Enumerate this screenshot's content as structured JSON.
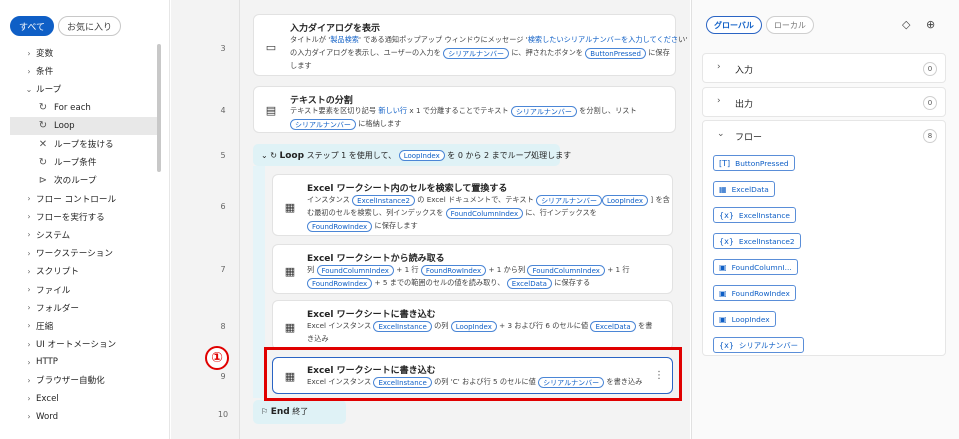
{
  "left_panel": {
    "chips": [
      "すべて",
      "お気に入り"
    ],
    "tree": [
      {
        "label": "変数",
        "type": "group"
      },
      {
        "label": "条件",
        "type": "group"
      },
      {
        "label": "ループ",
        "type": "group-open"
      },
      {
        "label": "For each",
        "type": "child",
        "icon": "loop-icon"
      },
      {
        "label": "Loop",
        "type": "child",
        "icon": "loop-icon",
        "selected": true
      },
      {
        "label": "ループを抜ける",
        "type": "child",
        "icon": "exit-loop-icon"
      },
      {
        "label": "ループ条件",
        "type": "child",
        "icon": "loop-icon"
      },
      {
        "label": "次のループ",
        "type": "child",
        "icon": "next-loop-icon"
      },
      {
        "label": "フロー コントロール",
        "type": "group"
      },
      {
        "label": "フローを実行する",
        "type": "group"
      },
      {
        "label": "システム",
        "type": "group"
      },
      {
        "label": "ワークステーション",
        "type": "group"
      },
      {
        "label": "スクリプト",
        "type": "group"
      },
      {
        "label": "ファイル",
        "type": "group"
      },
      {
        "label": "フォルダー",
        "type": "group"
      },
      {
        "label": "圧縮",
        "type": "group"
      },
      {
        "label": "UI オートメーション",
        "type": "group"
      },
      {
        "label": "HTTP",
        "type": "group"
      },
      {
        "label": "ブラウザー自動化",
        "type": "group"
      },
      {
        "label": "Excel",
        "type": "group"
      },
      {
        "label": "Word",
        "type": "group"
      }
    ]
  },
  "flow": {
    "line_numbers": [
      "3",
      "4",
      "5",
      "6",
      "7",
      "8",
      "9",
      "10"
    ],
    "a3": {
      "title": "入力ダイアログを表示",
      "d1a": "タイトルが '",
      "d1b": "製品検索",
      "d1c": "' である通知ポップアップ ウィンドウにメッセージ '",
      "d1d": "検索したいシリアルナンバーを入力してくださ",
      "d1e": "い'",
      "d2a": "の入力ダイアログを表示し、ユーザーの入力を",
      "t1": "シリアルナンバー",
      "d2b": "に、押されたボタンを",
      "t2": "ButtonPressed",
      "d2c": "に保存",
      "d3": "します"
    },
    "a4": {
      "title": "テキストの分割",
      "d1a": "テキスト要素を区切り記号",
      "d1b": "新しい行",
      "d1c": "x 1 で分離することでテキスト",
      "t1": "シリアルナンバー",
      "d1d": "を分割し、リスト",
      "t2": "シリアルナンバー",
      "d2": "に格納します"
    },
    "loop": {
      "label": "Loop",
      "a": "ステップ 1 を使用して、",
      "t1": "LoopIndex",
      "b": "を 0 から 2 までループ処理します"
    },
    "a6": {
      "title": "Excel ワークシート内のセルを検索して置換する",
      "d1a": "インスタンス",
      "t1": "ExcelInstance2",
      "d1b": "の Excel ドキュメントで、テキスト",
      "t2": "シリアルナンバー",
      "t3": "LoopIndex",
      "d1c": "] を含",
      "d2a": "む最初のセルを検索し、列インデックスを",
      "t4": "FoundColumnIndex",
      "d2b": "に、行インデックスを",
      "t5": "FoundRowIndex",
      "d3": "に保存します"
    },
    "a7": {
      "title": "Excel ワークシートから読み取る",
      "d1a": "列",
      "t1": "FoundColumnIndex",
      "d1b": "+ 1 行",
      "t2": "FoundRowIndex",
      "d1c": "+ 1 から列",
      "t3": "FoundColumnIndex",
      "d1d": "+ 1 行",
      "t4": "FoundRowIndex",
      "d2a": "+ 5 までの範囲のセルの値を読み取り、",
      "t5": "ExcelData",
      "d2b": "に保存する"
    },
    "a8": {
      "title": "Excel ワークシートに書き込む",
      "d1a": "Excel インスタンス",
      "t1": "ExcelInstance",
      "d1b": "の列",
      "t2": "LoopIndex",
      "d1c": "+ 3 および行 6 のセルに値",
      "t3": "ExcelData",
      "d1d": "を書",
      "d2": "き込み"
    },
    "a9": {
      "title": "Excel ワークシートに書き込む",
      "d1a": "Excel インスタンス",
      "t1": "ExcelInstance",
      "d1b": "の列 'C' および行 5 のセルに値",
      "t2": "シリアルナンバー",
      "d1c": "を書き込み",
      "menu": "⋮"
    },
    "end": {
      "label": "End",
      "suffix": "終了"
    },
    "annotation": "①"
  },
  "right_panel": {
    "tabs": [
      "グローバル",
      "ローカル"
    ],
    "sections": [
      {
        "name": "入力",
        "count": "0"
      },
      {
        "name": "出力",
        "count": "0"
      },
      {
        "name": "フロー",
        "count": "8"
      }
    ],
    "flow_vars": [
      {
        "name": "ButtonPressed",
        "icon": "text-var-icon",
        "glyph": "[T]"
      },
      {
        "name": "ExcelData",
        "icon": "table-var-icon",
        "glyph": "▦"
      },
      {
        "name": "ExcelInstance",
        "icon": "instance-var-icon",
        "glyph": "{x}"
      },
      {
        "name": "ExcelInstance2",
        "icon": "instance-var-icon",
        "glyph": "{x}"
      },
      {
        "name": "FoundColumnI...",
        "icon": "number-var-icon",
        "glyph": "▣"
      },
      {
        "name": "FoundRowIndex",
        "icon": "number-var-icon",
        "glyph": "▣"
      },
      {
        "name": "LoopIndex",
        "icon": "number-var-icon",
        "glyph": "▣"
      },
      {
        "name": "シリアルナンバー",
        "icon": "instance-var-icon",
        "glyph": "{x}"
      }
    ]
  }
}
